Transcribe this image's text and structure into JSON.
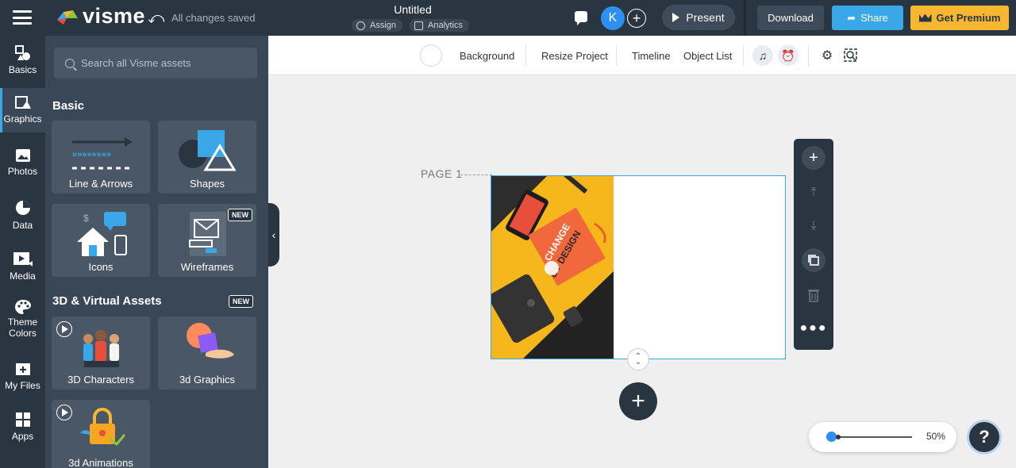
{
  "app": {
    "brand": "visme",
    "save_status": "All changes saved",
    "doc_title": "Untitled",
    "assign_label": "Assign",
    "analytics_label": "Analytics",
    "avatar_initial": "K",
    "present_label": "Present",
    "download_label": "Download",
    "share_label": "Share",
    "premium_label": "Get Premium"
  },
  "rail": {
    "items": [
      {
        "label": "Basics",
        "icon": "shapes-icon"
      },
      {
        "label": "Graphics",
        "icon": "graphics-icon",
        "active": true
      },
      {
        "label": "Photos",
        "icon": "photo-icon"
      },
      {
        "label": "Data",
        "icon": "pie-chart-icon"
      },
      {
        "label": "Media",
        "icon": "media-icon"
      },
      {
        "label": "Theme Colors",
        "line1": "Theme",
        "line2": "Colors",
        "icon": "palette-icon"
      },
      {
        "label": "My Files",
        "icon": "folder-icon"
      },
      {
        "label": "Apps",
        "icon": "apps-icon"
      }
    ]
  },
  "panel": {
    "search_placeholder": "Search all Visme assets",
    "basic_title": "Basic",
    "assets_title": "3D & Virtual Assets",
    "new_badge": "NEW",
    "cards": {
      "lines": "Line & Arrows",
      "shapes": "Shapes",
      "icons": "Icons",
      "wireframes": "Wireframes",
      "characters": "3D Characters",
      "graphics3d": "3d Graphics",
      "animations": "3d Animations"
    }
  },
  "toolbar": {
    "background": "Background",
    "resize": "Resize Project",
    "timeline": "Timeline",
    "object_list": "Object List"
  },
  "canvas": {
    "page_label": "PAGE 1",
    "photo_text_1": "CHANGE",
    "photo_text_2": "BY DESIGN"
  },
  "zoom": {
    "value_label": "50%",
    "level": 0.06
  },
  "help_label": "?",
  "colors": {
    "topbar": "#2a3542",
    "accent_blue": "#3aa7e8",
    "premium_yellow": "#f7b731",
    "panel": "#3a4756"
  }
}
